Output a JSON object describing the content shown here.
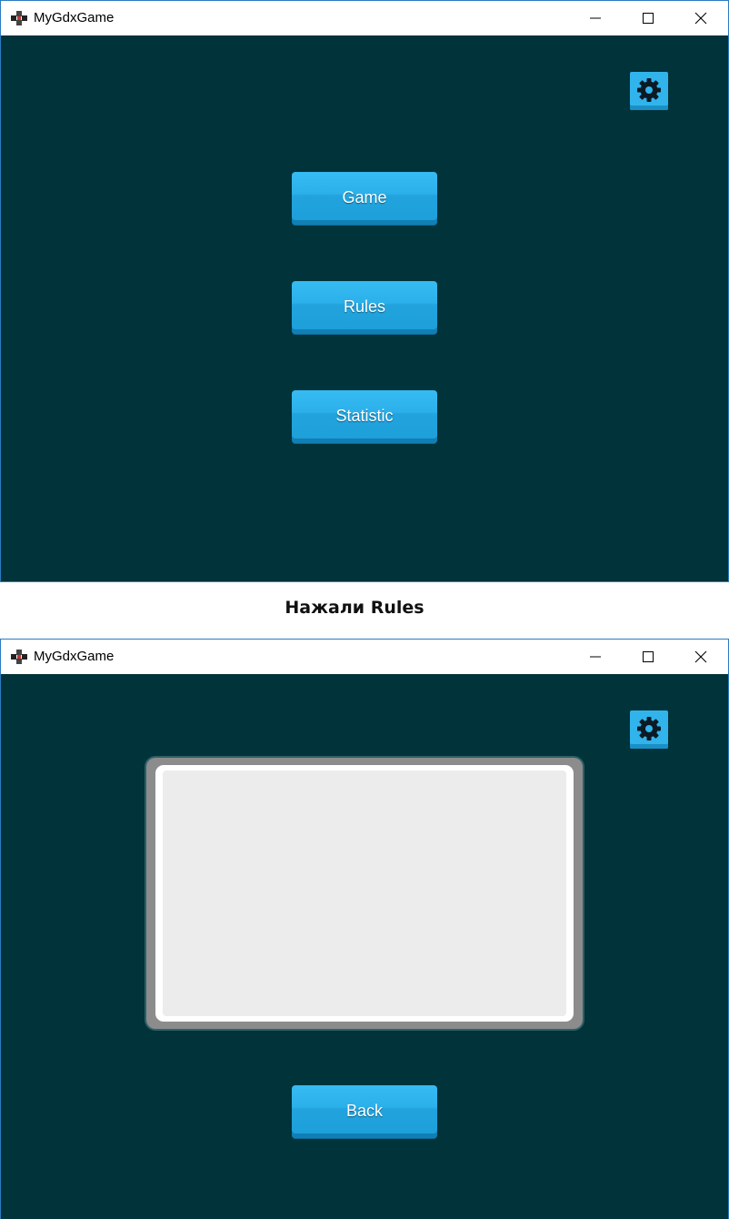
{
  "windows": [
    {
      "title": "MyGdxGame",
      "settings_icon": "gear-icon",
      "menu_buttons": [
        {
          "label": "Game"
        },
        {
          "label": "Rules"
        },
        {
          "label": "Statistic"
        }
      ]
    },
    {
      "title": "MyGdxGame",
      "settings_icon": "gear-icon",
      "back_label": "Back"
    }
  ],
  "caption": "Нажали Rules",
  "colors": {
    "background": "#00333a",
    "button": "#2cb0ea",
    "panel_fill": "#ececec",
    "panel_border": "#8c8c8c"
  }
}
